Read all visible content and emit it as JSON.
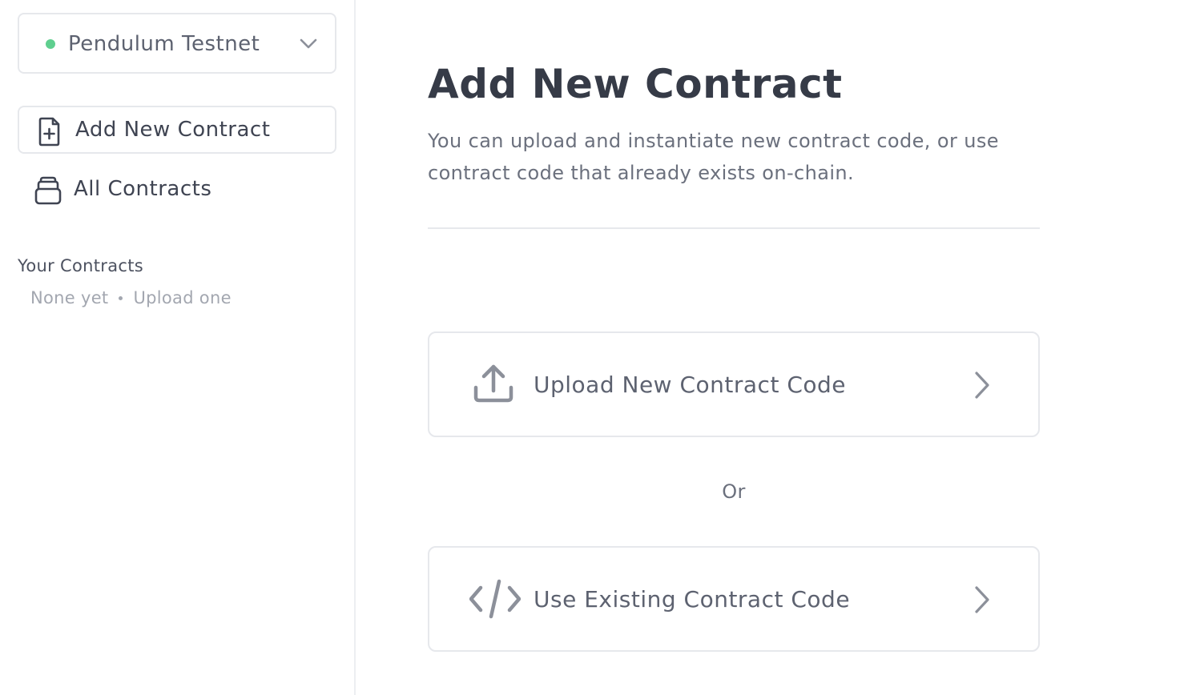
{
  "sidebar": {
    "network": {
      "label": "Pendulum Testnet",
      "status_color": "#5fcf8f"
    },
    "nav": [
      {
        "label": "Add New Contract",
        "icon": "file-plus-icon",
        "active": true
      },
      {
        "label": "All Contracts",
        "icon": "stack-icon",
        "active": false
      }
    ],
    "your_contracts": {
      "heading": "Your Contracts",
      "empty_text": "None yet",
      "upload_link": "Upload one"
    }
  },
  "main": {
    "title": "Add New Contract",
    "description": "You can upload and instantiate new contract code, or use contract code that already exists on-chain.",
    "options": [
      {
        "label": "Upload New Contract Code",
        "icon": "upload-icon"
      },
      {
        "label": "Use Existing Contract Code",
        "icon": "code-icon"
      }
    ],
    "separator": "Or"
  },
  "colors": {
    "icon_gray": "#8c909a",
    "text_dark": "#363b47",
    "border": "#e6e8ec"
  }
}
